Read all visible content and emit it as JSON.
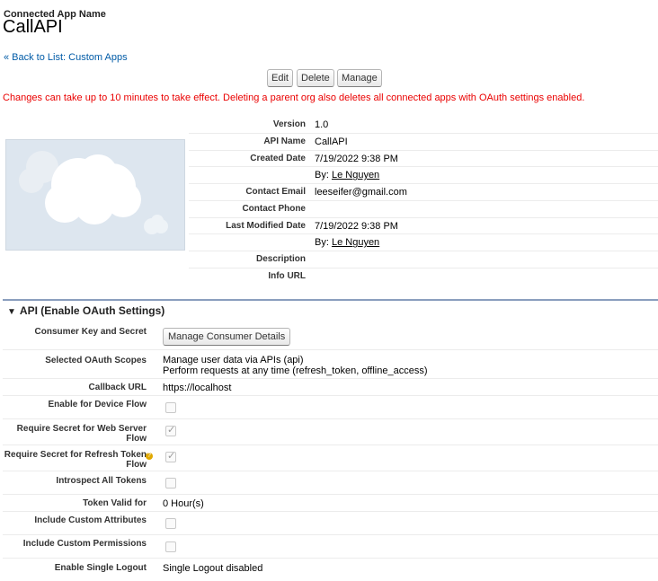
{
  "header": {
    "subtitle": "Connected App Name",
    "title": "CallAPI",
    "back_link": "« Back to List: Custom Apps"
  },
  "buttons": {
    "edit": "Edit",
    "delete": "Delete",
    "manage": "Manage"
  },
  "warning": "Changes can take up to 10 minutes to take effect. Deleting a parent org also deletes all connected apps with OAuth settings enabled.",
  "details": {
    "version": {
      "label": "Version",
      "value": "1.0"
    },
    "api_name": {
      "label": "API Name",
      "value": "CallAPI"
    },
    "created_date": {
      "label": "Created Date",
      "value": "7/19/2022 9:38 PM",
      "by_prefix": "By:",
      "by_user": "Le Nguyen"
    },
    "contact_email": {
      "label": "Contact Email",
      "value": "leeseifer@gmail.com"
    },
    "contact_phone": {
      "label": "Contact Phone",
      "value": ""
    },
    "last_modified": {
      "label": "Last Modified Date",
      "value": "7/19/2022 9:38 PM",
      "by_prefix": "By:",
      "by_user": "Le Nguyen"
    },
    "description": {
      "label": "Description",
      "value": ""
    },
    "info_url": {
      "label": "Info URL",
      "value": ""
    }
  },
  "oauth": {
    "section_title": "API (Enable OAuth Settings)",
    "consumer_key": {
      "label": "Consumer Key and Secret",
      "button": "Manage Consumer Details"
    },
    "scopes": {
      "label": "Selected OAuth Scopes",
      "line1": "Manage user data via APIs (api)",
      "line2": "Perform requests at any time (refresh_token, offline_access)"
    },
    "callback_url": {
      "label": "Callback URL",
      "value": "https://localhost"
    },
    "device_flow": {
      "label": "Enable for Device Flow",
      "checked": false
    },
    "secret_web": {
      "label": "Require Secret for Web Server Flow",
      "checked": true
    },
    "secret_refresh": {
      "label": "Require Secret for Refresh Token Flow",
      "checked": true
    },
    "introspect": {
      "label": "Introspect All Tokens",
      "checked": false
    },
    "token_valid": {
      "label": "Token Valid for",
      "value": "0 Hour(s)"
    },
    "custom_attrs": {
      "label": "Include Custom Attributes",
      "checked": false
    },
    "custom_perms": {
      "label": "Include Custom Permissions",
      "checked": false
    },
    "single_logout": {
      "label": "Enable Single Logout",
      "value": "Single Logout disabled"
    }
  },
  "icons": {
    "collapse": "triangle-down-icon",
    "help": "help-icon",
    "logo": "cloud-logo",
    "checkbox_color": "#9a9a9a"
  }
}
